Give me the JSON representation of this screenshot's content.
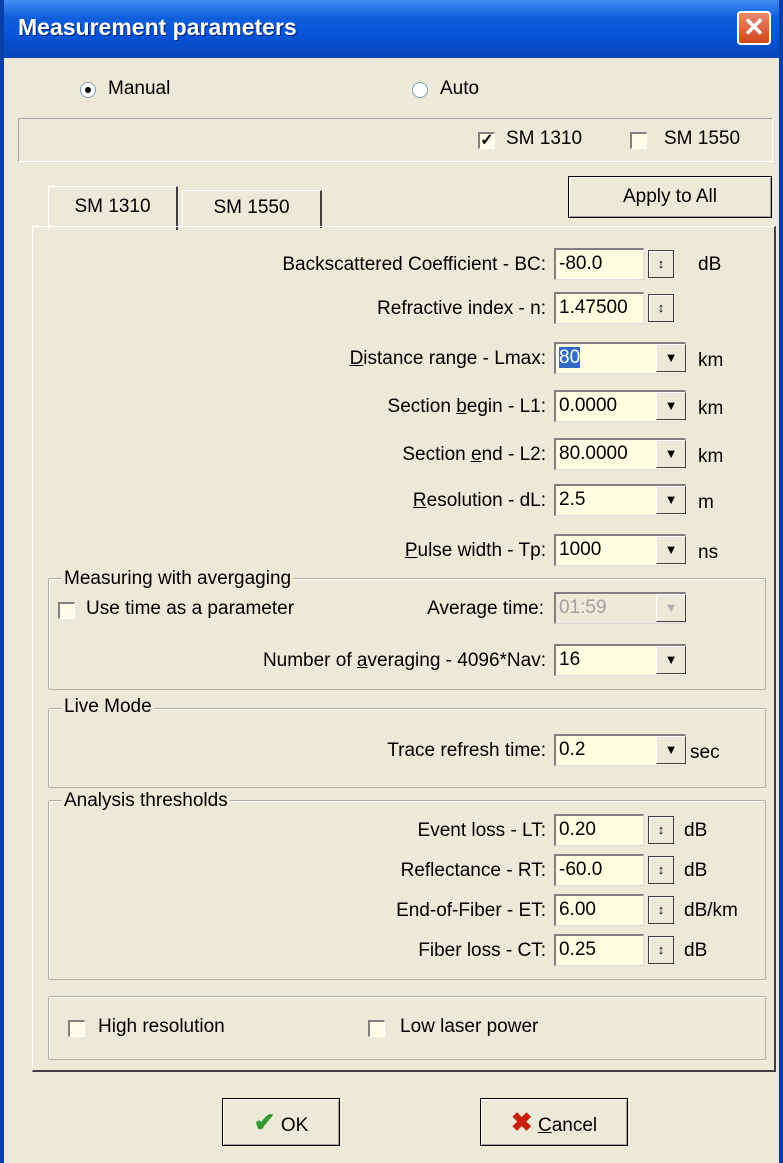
{
  "window": {
    "title": "Measurement parameters",
    "close_glyph": "✕"
  },
  "mode": {
    "manual_label": "Manual",
    "auto_label": "Auto",
    "selected": "Manual"
  },
  "wavelengths": [
    {
      "label": "SM 1310",
      "checked": true
    },
    {
      "label": "SM 1550",
      "checked": false
    }
  ],
  "tabs": [
    {
      "label": "SM 1310",
      "active": true
    },
    {
      "label": "SM 1550",
      "active": false
    }
  ],
  "apply_all_label": "Apply to All",
  "params": {
    "bc": {
      "label": "Backscattered Coefficient - BC:",
      "value": "-80.0",
      "unit": "dB"
    },
    "n": {
      "label": "Refractive index - n:",
      "value": "1.47500",
      "unit": ""
    },
    "lmax": {
      "label_pre": "",
      "label_u": "D",
      "label_post": "istance range - Lmax:",
      "value": "80",
      "unit": "km"
    },
    "l1": {
      "label_pre": "Section ",
      "label_u": "b",
      "label_post": "egin - L1:",
      "value": "0.0000",
      "unit": "km"
    },
    "l2": {
      "label_pre": "Section ",
      "label_u": "e",
      "label_post": "nd - L2:",
      "value": "80.0000",
      "unit": "km"
    },
    "dl": {
      "label_pre": "",
      "label_u": "R",
      "label_post": "esolution - dL:",
      "value": "2.5",
      "unit": "m"
    },
    "tp": {
      "label_pre": "",
      "label_u": "P",
      "label_post": "ulse width - Tp:",
      "value": "1000",
      "unit": "ns"
    }
  },
  "averaging": {
    "legend": "Measuring with avergaging",
    "use_time_label": "Use time as a parameter",
    "use_time_checked": false,
    "avg_time_label": "Average time:",
    "avg_time_value": "01:59",
    "nav_label_pre": "Number of ",
    "nav_label_u": "a",
    "nav_label_post": "veraging - 4096*Nav:",
    "nav_value": "16"
  },
  "live": {
    "legend": "Live Mode",
    "refresh_label": "Trace refresh time:",
    "refresh_value": "0.2",
    "unit": "sec"
  },
  "analysis": {
    "legend": "Analysis thresholds",
    "rows": [
      {
        "label": "Event loss - LT:",
        "value": "0.20",
        "unit": "dB"
      },
      {
        "label": "Reflectance - RT:",
        "value": "-60.0",
        "unit": "dB"
      },
      {
        "label": "End-of-Fiber - ET:",
        "value": "6.00",
        "unit": "dB/km"
      },
      {
        "label": "Fiber loss - CT:",
        "value": "0.25",
        "unit": "dB"
      }
    ]
  },
  "options": {
    "high_res_label": "High resolution",
    "low_power_label": "Low laser power"
  },
  "footer": {
    "ok_label": "OK",
    "cancel_label_u": "C",
    "cancel_label_post": "ancel"
  },
  "icons": {
    "ok": "check-icon",
    "cancel": "x-icon",
    "spin": "spin-arrows-icon",
    "dropdown": "chevron-down-icon"
  },
  "colors": {
    "titlebar": "#0654d7",
    "field_bg": "#fffbe0",
    "selection": "#316ac5",
    "ok_check": "#2e9a2e",
    "cancel_x": "#c81e0a"
  }
}
